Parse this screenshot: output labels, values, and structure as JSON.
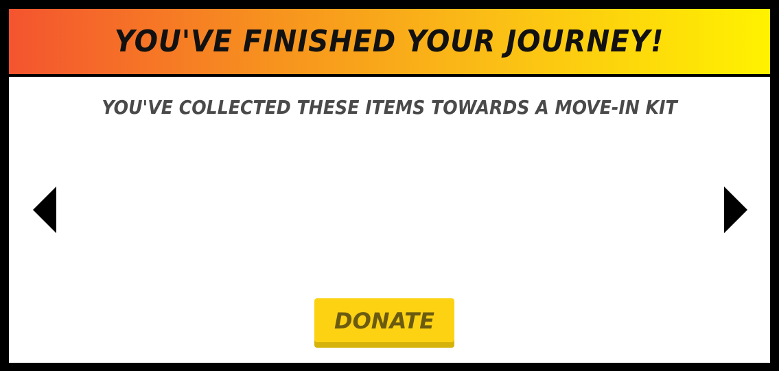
{
  "header": {
    "title": "You've finished your journey!"
  },
  "main": {
    "subtitle": "You've collected these items towards a move-in kit",
    "donate_label": "Donate"
  },
  "icons": {
    "prev": "triangle-left-icon",
    "next": "triangle-right-icon"
  },
  "colors": {
    "header_gradient_start": "#f4542f",
    "header_gradient_end": "#fff200",
    "donate_button": "#fcd213",
    "frame": "#000000"
  }
}
